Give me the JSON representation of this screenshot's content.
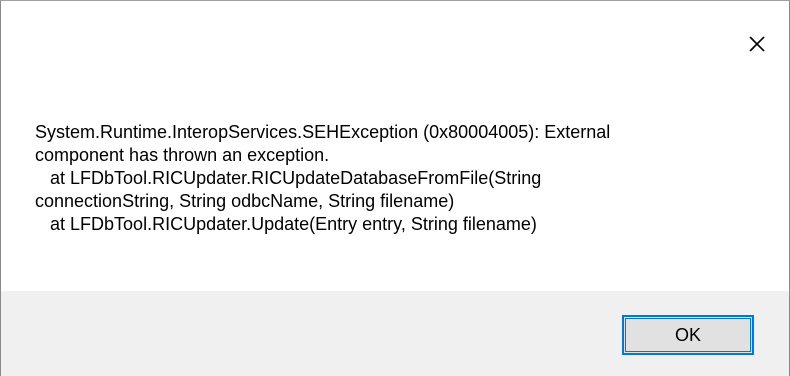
{
  "dialog": {
    "message": "System.Runtime.InteropServices.SEHException (0x80004005): External\ncomponent has thrown an exception.\n   at LFDbTool.RICUpdater.RICUpdateDatabaseFromFile(String\nconnectionString, String odbcName, String filename)\n   at LFDbTool.RICUpdater.Update(Entry entry, String filename)",
    "ok_label": "OK",
    "close_icon": "close-icon"
  },
  "colors": {
    "button_accent": "#0078d7",
    "button_bar_background": "#f0f0f0",
    "button_face": "#e1e1e1"
  }
}
